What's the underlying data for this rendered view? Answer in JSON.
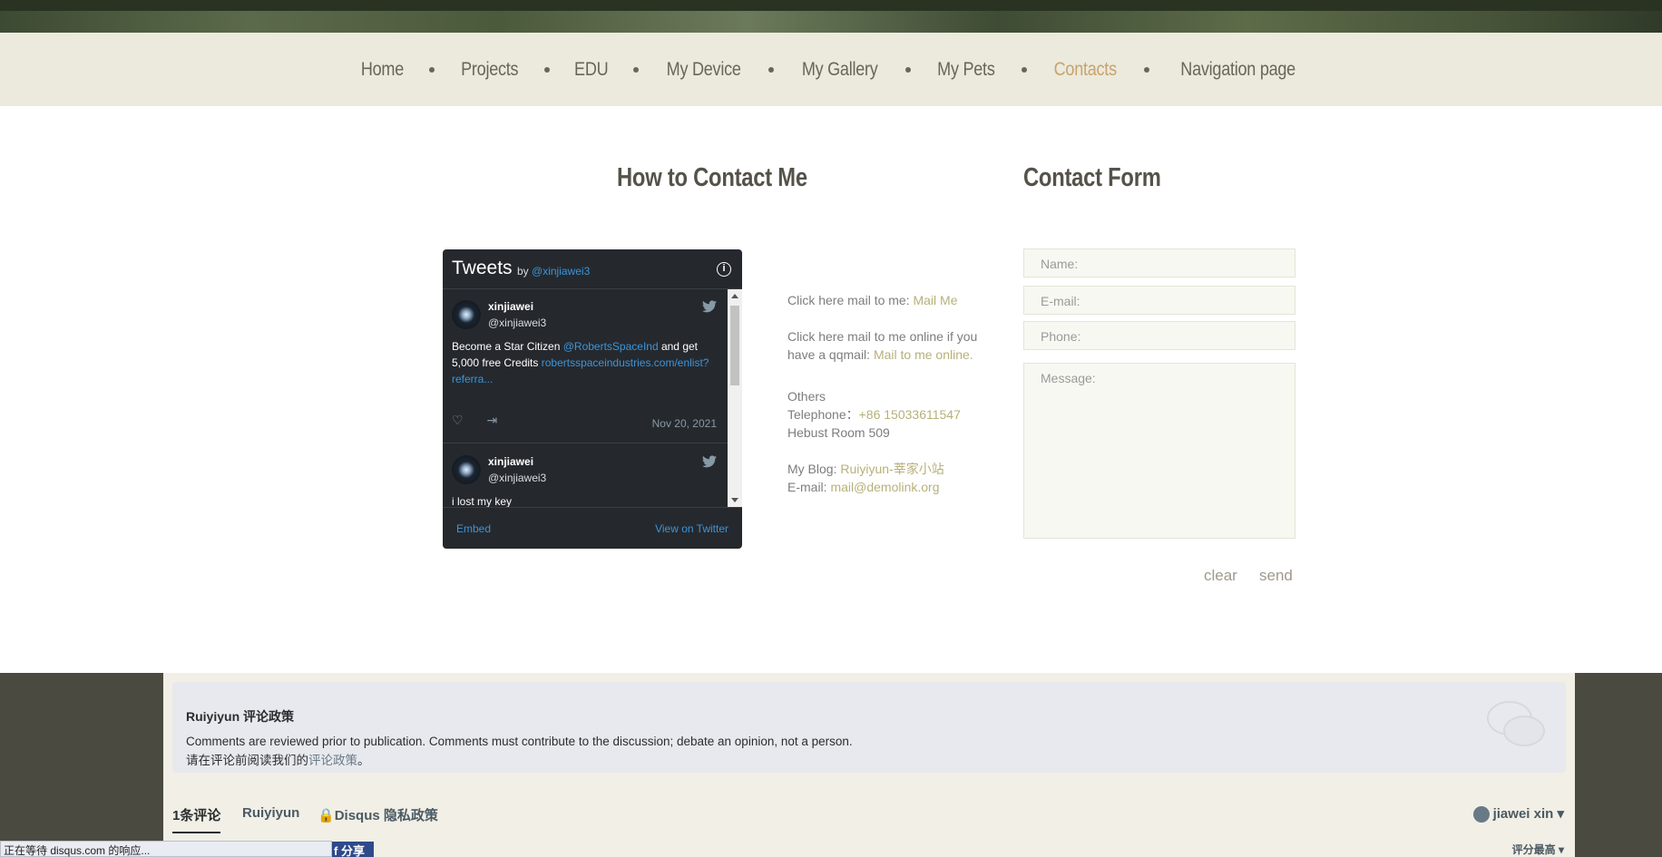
{
  "nav": {
    "items": [
      "Home",
      "Projects",
      "EDU",
      "My Device",
      "My Gallery",
      "My Pets",
      "Contacts",
      "Navigation page"
    ]
  },
  "contact": {
    "heading": "How to Contact Me",
    "form_heading": "Contact Form",
    "mail_prefix": "Click here mail to me: ",
    "mail_link": "Mail Me",
    "online_line1": "Click here mail to me online if you",
    "online_prefix": "have a qqmail: ",
    "online_link": "Mail to me online.",
    "others": "Others",
    "tel_label": "Telephone：",
    "tel_value": "+86 15033611547",
    "address": "Hebust Room 509",
    "blog_label": "My Blog: ",
    "blog_link": "Ruiyiyun-莘家小站",
    "email_label": "E-mail: ",
    "email_link": "mail@demolink.org"
  },
  "form": {
    "name_placeholder": "Name:",
    "email_placeholder": "E-mail:",
    "phone_placeholder": "Phone:",
    "message_placeholder": "Message:",
    "clear": "clear",
    "send": "send"
  },
  "twitter": {
    "title": "Tweets",
    "by": "by",
    "handle": "@xinjiawei3",
    "info_icon": "info-icon",
    "tweets": [
      {
        "name": "xinjiawei",
        "user": "@xinjiawei3",
        "text_prefix": "Become a Star Citizen ",
        "mention": "@RobertsSpaceInd",
        "text_mid": " and get 5,000 free Credits ",
        "url": "robertsspaceindustries.com/enlist?referra...",
        "date": "Nov 20, 2021"
      },
      {
        "name": "xinjiawei",
        "user": "@xinjiawei3",
        "text_prefix": "i lost my key"
      }
    ],
    "embed": "Embed",
    "view": "View on Twitter"
  },
  "disqus": {
    "policy_title": "Ruiyiyun 评论政策",
    "policy_text": "Comments are reviewed prior to publication. Comments must contribute to the discussion; debate an opinion, not a person.",
    "policy_text2_prefix": "请在评论前阅读我们的",
    "policy_link": "评论政策",
    "policy_text2_suffix": "。",
    "tab_comments": "1条评论",
    "tab_site": "Ruiyiyun",
    "tab_privacy": "Disqus 隐私政策",
    "user": "jiawei xin",
    "sort": "评分最高",
    "share": "分享"
  },
  "status": {
    "text": "正在等待 disqus.com 的响应..."
  },
  "colors": {
    "nav_bg": "#ebeadc",
    "accent": "#c8a26c",
    "link": "#b7b07a",
    "twitter_bg": "#25292e",
    "twitter_link": "#3b94d9"
  }
}
